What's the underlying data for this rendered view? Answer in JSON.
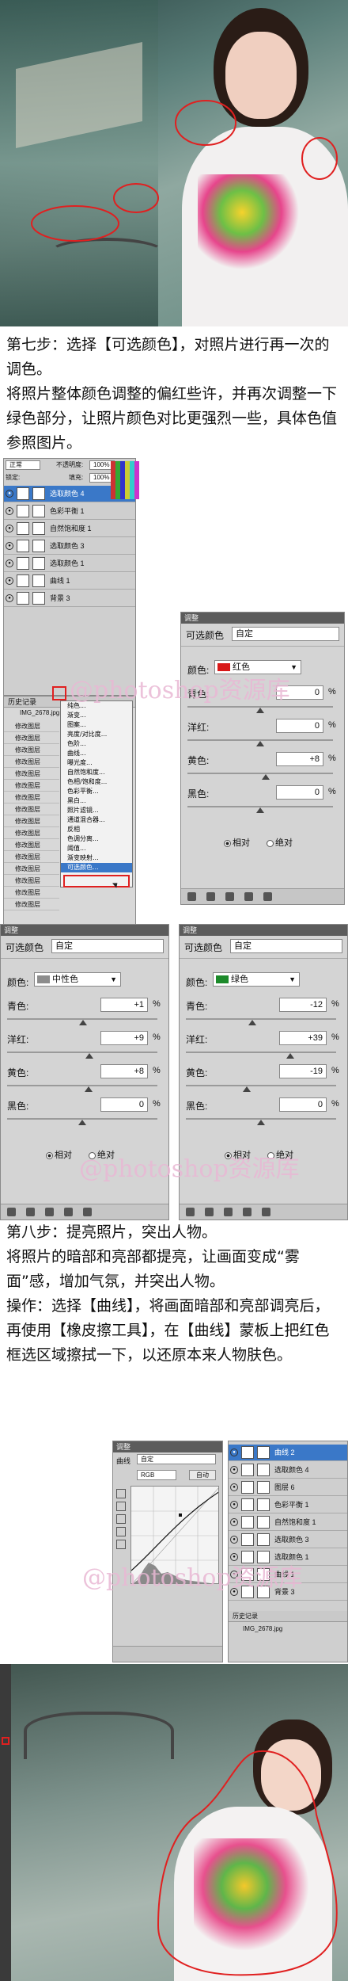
{
  "step7": {
    "title": "第七步：选择【可选颜色】，对照片进行再一次的调色。",
    "body": "将照片整体颜色调整的偏红些许，并再次调整一下绿色部分，让照片颜色对比更强烈一些，具体色值参照图片。"
  },
  "step8": {
    "title": "第八步：提亮照片，突出人物。",
    "body1": "将照片的暗部和亮部都提亮，让画面变成“雾面”感，增加气氛，并突出人物。",
    "body2": "操作：选择【曲线】，将画面暗部和亮部调亮后，再使用【橡皮擦工具】，在【曲线】蒙板上把红色框选区域擦拭一下，以还原本来人物肤色。"
  },
  "watermark": "@photoshop资源库",
  "layers_panel": {
    "blend_mode": "正常",
    "opacity_label": "不透明度:",
    "opacity": "100%",
    "lock_label": "锁定:",
    "fill_label": "填充:",
    "fill": "100%",
    "layers": [
      "选取颜色 4",
      "色彩平衡 1",
      "自然饱和度 1",
      "选取颜色 3",
      "选取颜色 1",
      "曲线 1",
      "背景 3"
    ]
  },
  "history_panel": {
    "title": "历史记录",
    "file": "IMG_2678.jpg",
    "items": [
      "修改图层",
      "修改图层",
      "修改图层",
      "修改图层",
      "修改图层",
      "修改图层",
      "修改图层",
      "修改图层",
      "修改图层",
      "修改图层",
      "修改图层",
      "修改图层",
      "修改图层",
      "修改图层",
      "修改图层",
      "修改图层"
    ]
  },
  "adjust_menu": {
    "items": [
      "纯色...",
      "渐变...",
      "图案...",
      "亮度/对比度...",
      "色阶...",
      "曲线...",
      "曝光度...",
      "自然饱和度...",
      "色相/饱和度...",
      "色彩平衡...",
      "黑白...",
      "照片滤镜...",
      "通道混合器...",
      "反相",
      "色调分离...",
      "阈值...",
      "渐变映射...",
      "可选颜色..."
    ],
    "selected": "可选颜色..."
  },
  "sc_red": {
    "tab": "调整",
    "title": "可选颜色",
    "preset": "自定",
    "color_label": "颜色:",
    "color": "红色",
    "swatch": "#d81818",
    "cyan_label": "青色:",
    "cyan": "0",
    "magenta_label": "洋红:",
    "magenta": "0",
    "yellow_label": "黄色:",
    "yellow": "+8",
    "black_label": "黑色:",
    "black": "0",
    "relative": "相对",
    "absolute": "绝对",
    "unit": "%"
  },
  "sc_neutral": {
    "tab": "调整",
    "title": "可选颜色",
    "preset": "自定",
    "color_label": "颜色:",
    "color": "中性色",
    "swatch": "#8c8c8c",
    "cyan_label": "青色:",
    "cyan": "+1",
    "magenta_label": "洋红:",
    "magenta": "+9",
    "yellow_label": "黄色:",
    "yellow": "+8",
    "black_label": "黑色:",
    "black": "0",
    "relative": "相对",
    "absolute": "绝对",
    "unit": "%"
  },
  "sc_green": {
    "tab": "调整",
    "title": "可选颜色",
    "preset": "自定",
    "color_label": "颜色:",
    "color": "绿色",
    "swatch": "#1c8a2a",
    "cyan_label": "青色:",
    "cyan": "-12",
    "magenta_label": "洋红:",
    "magenta": "+39",
    "yellow_label": "黄色:",
    "yellow": "-19",
    "black_label": "黑色:",
    "black": "0",
    "relative": "相对",
    "absolute": "绝对",
    "unit": "%"
  },
  "curves_panel": {
    "tab": "调整",
    "title": "曲线",
    "preset": "自定",
    "channel": "RGB",
    "auto": "自动"
  },
  "layers_panel2": {
    "layers": [
      "曲线 2",
      "选取颜色 4",
      "图层 6",
      "色彩平衡 1",
      "自然饱和度 1",
      "选取颜色 3",
      "选取颜色 1",
      "曲线 1",
      "背景 3"
    ],
    "history_title": "历史记录",
    "file": "IMG_2678.jpg"
  },
  "colors": {
    "accent": "#3a78c8",
    "red_circle": "#e02020"
  }
}
